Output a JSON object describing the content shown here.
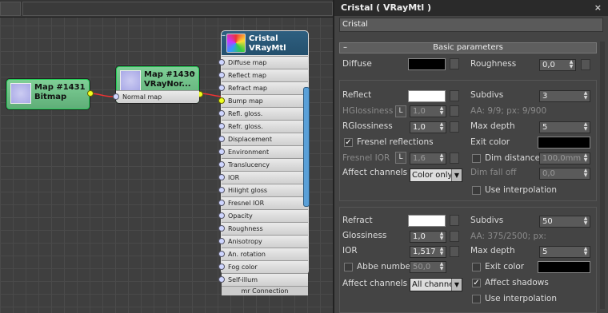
{
  "graph": {
    "bitmap_node": {
      "title": "Map #1431",
      "subtitle": "Bitmap"
    },
    "normal_node": {
      "title": "Map #1430",
      "subtitle": "VRayNor...",
      "slot": "Normal map"
    },
    "vray_node": {
      "title": "Cristal",
      "subtitle": "VRayMtl",
      "footer": "mr Connection",
      "slots": [
        "Diffuse map",
        "Reflect map",
        "Refract map",
        "Bump map",
        "Refl. gloss.",
        "Refr. gloss.",
        "Displacement",
        "Environment",
        "Translucency",
        "IOR",
        "Hilight gloss",
        "Fresnel IOR",
        "Opacity",
        "Roughness",
        "Anisotropy",
        "An. rotation",
        "Fog color",
        "Self-illum"
      ]
    }
  },
  "panel": {
    "title": "Cristal  ( VRayMtl )",
    "name": "Cristal",
    "rollout_title": "Basic parameters",
    "diffuse": {
      "label": "Diffuse",
      "color": "#000000",
      "roughness_label": "Roughness",
      "roughness": "0,0"
    },
    "reflect": {
      "label": "Reflect",
      "color": "#ffffff",
      "subdivs_label": "Subdivs",
      "subdivs": "3",
      "aa_info": "AA: 9/9; px: 9/900",
      "hgloss_label": "HGlossiness",
      "hgloss": "1,0",
      "rgloss_label": "RGlossiness",
      "rgloss": "1,0",
      "max_depth_label": "Max depth",
      "max_depth": "5",
      "fresnel_label": "Fresnel reflections",
      "fresnel_checked": "✓",
      "exit_color_label": "Exit color",
      "exit_color": "#000000",
      "fresnel_ior_label": "Fresnel IOR",
      "fresnel_ior": "1,6",
      "dim_distance_label": "Dim distance",
      "dim_distance": "100,0mm",
      "dim_falloff_label": "Dim fall off",
      "dim_falloff": "0,0",
      "affect_channels_label": "Affect channels",
      "affect_channels": "Color only",
      "use_interp_label": "Use interpolation",
      "lock": "L"
    },
    "refract": {
      "label": "Refract",
      "color": "#ffffff",
      "subdivs_label": "Subdivs",
      "subdivs": "50",
      "aa_info": "AA: 375/2500; px:",
      "gloss_label": "Glossiness",
      "gloss": "1,0",
      "ior_label": "IOR",
      "ior": "1,517",
      "max_depth_label": "Max depth",
      "max_depth": "5",
      "abbe_label": "Abbe number",
      "abbe": "50,0",
      "exit_color_label": "Exit color",
      "exit_color": "#000000",
      "affect_channels_label": "Affect channels",
      "affect_channels": "All channels",
      "affect_shadows_label": "Affect shadows",
      "affect_shadows_checked": "✓",
      "use_interp_label": "Use interpolation"
    },
    "close_glyph": "×",
    "collapse_glyph": "–"
  }
}
